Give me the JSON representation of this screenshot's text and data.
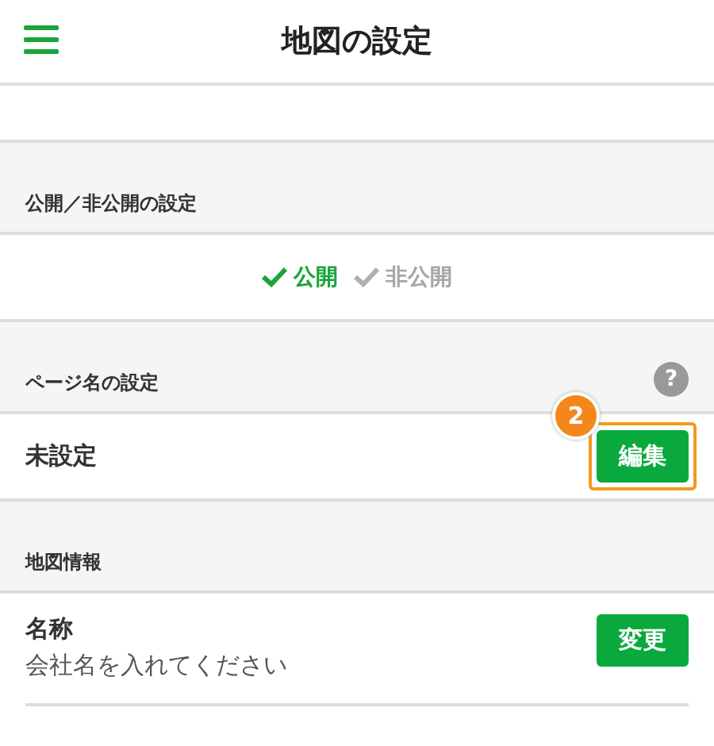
{
  "header": {
    "title": "地図の設定"
  },
  "visibility": {
    "label": "公開／非公開の設定",
    "options": [
      {
        "label": "公開",
        "selected": true
      },
      {
        "label": "非公開",
        "selected": false
      }
    ]
  },
  "page_name": {
    "label": "ページ名の設定",
    "help": "?",
    "value": "未設定",
    "button": {
      "label": "編集",
      "highlighted": true,
      "callout": "2"
    }
  },
  "map_info": {
    "label": "地図情報",
    "fields": [
      {
        "name": "名称",
        "value": "会社名を入れてください",
        "button": "変更"
      }
    ]
  }
}
